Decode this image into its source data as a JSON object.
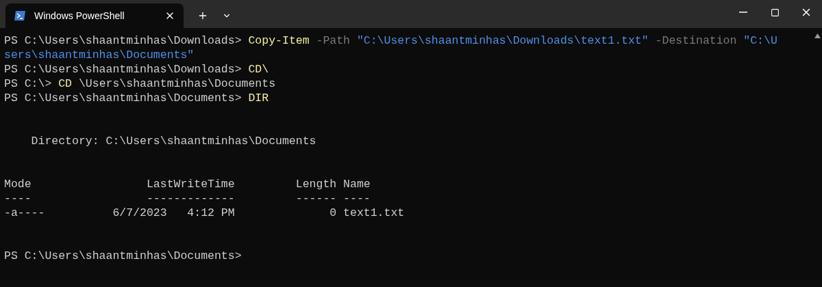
{
  "tabs": [
    {
      "title": "Windows PowerShell",
      "selected": true
    }
  ],
  "terminal": {
    "lines": [
      {
        "kind": "text",
        "segments": [
          {
            "kind": "prompt",
            "text": "PS C:\\Users\\shaantminhas\\Downloads> "
          },
          {
            "kind": "command",
            "text": "Copy-Item"
          },
          {
            "kind": "parameter",
            "text": " -Path "
          },
          {
            "kind": "string",
            "text": "\"C:\\Users\\shaantminhas\\Downloads\\text1.txt\""
          },
          {
            "kind": "parameter",
            "text": " -Destination "
          },
          {
            "kind": "string",
            "text": "\"C:\\U"
          }
        ]
      },
      {
        "kind": "text",
        "segments": [
          {
            "kind": "string",
            "text": "sers\\shaantminhas\\Documents\""
          }
        ]
      },
      {
        "kind": "text",
        "segments": [
          {
            "kind": "prompt",
            "text": "PS C:\\Users\\shaantminhas\\Downloads> "
          },
          {
            "kind": "command",
            "text": "CD\\"
          }
        ]
      },
      {
        "kind": "text",
        "segments": [
          {
            "kind": "prompt",
            "text": "PS C:\\> "
          },
          {
            "kind": "command",
            "text": "CD"
          },
          {
            "kind": "prompt",
            "text": " \\Users\\shaantminhas\\Documents"
          }
        ]
      },
      {
        "kind": "text",
        "segments": [
          {
            "kind": "prompt",
            "text": "PS C:\\Users\\shaantminhas\\Documents> "
          },
          {
            "kind": "command",
            "text": "DIR"
          }
        ]
      },
      {
        "kind": "blank"
      },
      {
        "kind": "blank"
      },
      {
        "kind": "text",
        "segments": [
          {
            "kind": "output",
            "text": "    Directory: C:\\Users\\shaantminhas\\Documents"
          }
        ]
      },
      {
        "kind": "blank"
      },
      {
        "kind": "blank"
      },
      {
        "kind": "text",
        "segments": [
          {
            "kind": "output",
            "text": "Mode                 LastWriteTime         Length Name"
          }
        ]
      },
      {
        "kind": "text",
        "segments": [
          {
            "kind": "output",
            "text": "----                 -------------         ------ ----"
          }
        ]
      },
      {
        "kind": "text",
        "segments": [
          {
            "kind": "output",
            "text": "-a----          6/7/2023   4:12 PM              0 text1.txt"
          }
        ]
      },
      {
        "kind": "blank"
      },
      {
        "kind": "blank"
      },
      {
        "kind": "text",
        "segments": [
          {
            "kind": "prompt",
            "text": "PS C:\\Users\\shaantminhas\\Documents>"
          }
        ]
      }
    ]
  }
}
